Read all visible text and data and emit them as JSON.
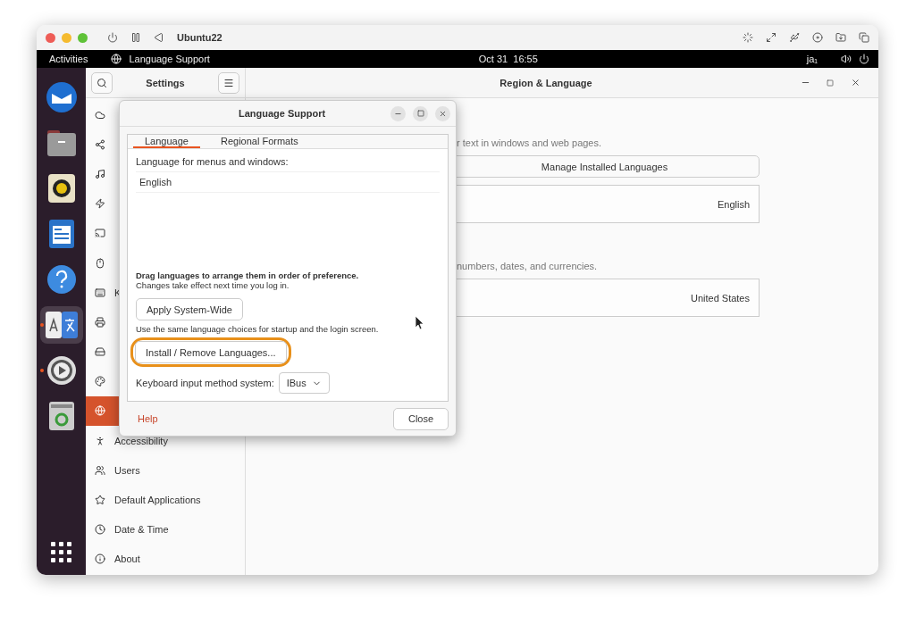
{
  "vm_window": {
    "title": "Ubuntu22"
  },
  "top_bar": {
    "activities": "Activities",
    "app": "Language Support",
    "clock": "Oct 31  16:55",
    "input_method": "ja₁"
  },
  "dock": [
    {
      "running": false,
      "selected": false
    },
    {
      "running": false,
      "selected": false
    },
    {
      "running": false,
      "selected": false
    },
    {
      "running": false,
      "selected": false
    },
    {
      "running": false,
      "selected": false
    },
    {
      "running": true,
      "selected": true
    },
    {
      "running": true,
      "selected": false
    },
    {
      "running": false,
      "selected": false
    }
  ],
  "settings": {
    "title": "Settings",
    "sidebar": [
      {
        "selected": false
      },
      {
        "selected": false
      },
      {
        "selected": false
      },
      {
        "selected": false
      },
      {
        "selected": false
      },
      {
        "selected": false
      },
      {
        "label": "K",
        "selected": false
      },
      {
        "selected": false
      },
      {
        "selected": false
      },
      {
        "selected": false
      },
      {
        "selected": true
      },
      {
        "label": "Accessibility",
        "selected": false
      },
      {
        "label": "Users",
        "selected": false
      },
      {
        "label": "Default Applications",
        "selected": false
      },
      {
        "label": "Date & Time",
        "selected": false
      },
      {
        "label": "About",
        "selected": false
      }
    ]
  },
  "main": {
    "title": "Region & Language",
    "language_hint": "r text in windows and web pages.",
    "manage_button": "Manage Installed Languages",
    "language_value": "English",
    "formats_hint": "numbers, dates, and currencies.",
    "formats_value": "United States"
  },
  "dialog": {
    "title": "Language Support",
    "tabs": [
      {
        "label": "Language",
        "selected": true
      },
      {
        "label": "Regional Formats",
        "selected": false
      }
    ],
    "menus_label": "Language for menus and windows:",
    "languages": [
      "English"
    ],
    "drag_hint": "Drag languages to arrange them in order of preference.",
    "drag_note": "Changes take effect next time you log in.",
    "apply_button": "Apply System-Wide",
    "apply_note": "Use the same language choices for startup and the login screen.",
    "install_button": {
      "label": "Install / Remove Languages...",
      "highlighted": true
    },
    "input_method_label": "Keyboard input method system:",
    "input_method": "IBus",
    "help": "Help",
    "close": "Close"
  }
}
